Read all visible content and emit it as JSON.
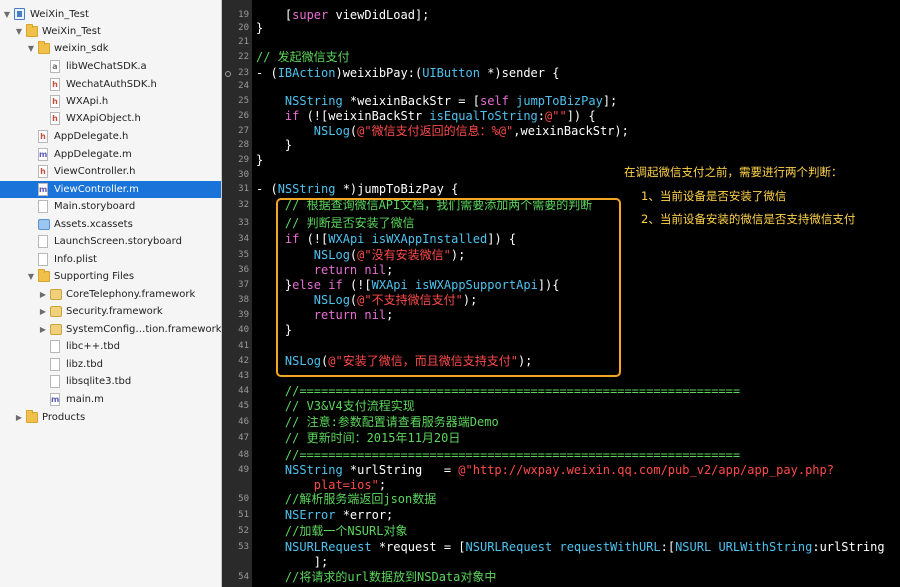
{
  "navigator": {
    "items": [
      {
        "label": "WeiXin_Test",
        "icon": "project-icon"
      },
      {
        "label": "WeiXin_Test",
        "icon": "group-folder-icon"
      },
      {
        "label": "weixin_sdk",
        "icon": "group-folder-icon"
      },
      {
        "label": "libWeChatSDK.a",
        "icon": "library-file-icon"
      },
      {
        "label": "WechatAuthSDK.h",
        "icon": "header-file-icon"
      },
      {
        "label": "WXApi.h",
        "icon": "header-file-icon"
      },
      {
        "label": "WXApiObject.h",
        "icon": "header-file-icon"
      },
      {
        "label": "AppDelegate.h",
        "icon": "header-file-icon"
      },
      {
        "label": "AppDelegate.m",
        "icon": "implementation-file-icon"
      },
      {
        "label": "ViewController.h",
        "icon": "header-file-icon"
      },
      {
        "label": "ViewController.m",
        "icon": "implementation-file-icon"
      },
      {
        "label": "Main.storyboard",
        "icon": "storyboard-file-icon"
      },
      {
        "label": "Assets.xcassets",
        "icon": "asset-catalog-icon"
      },
      {
        "label": "LaunchScreen.storyboard",
        "icon": "storyboard-file-icon"
      },
      {
        "label": "Info.plist",
        "icon": "plist-file-icon"
      },
      {
        "label": "Supporting Files",
        "icon": "group-folder-icon"
      },
      {
        "label": "CoreTelephony.framework",
        "icon": "framework-icon"
      },
      {
        "label": "Security.framework",
        "icon": "framework-icon"
      },
      {
        "label": "SystemConfig…tion.framework",
        "icon": "framework-icon"
      },
      {
        "label": "libc++.tbd",
        "icon": "library-file-icon"
      },
      {
        "label": "libz.tbd",
        "icon": "library-file-icon"
      },
      {
        "label": "libsqlite3.tbd",
        "icon": "library-file-icon"
      },
      {
        "label": "main.m",
        "icon": "implementation-file-icon"
      },
      {
        "label": "Products",
        "icon": "group-folder-icon"
      }
    ],
    "selected": "ViewController.m"
  },
  "editor": {
    "line_numbers": [
      "19",
      "20",
      "21",
      "22",
      "23",
      "24",
      "25",
      "26",
      "27",
      "28",
      "29",
      "30",
      "31",
      "32",
      "33",
      "34",
      "35",
      "36",
      "37",
      "38",
      "39",
      "40",
      "41",
      "42",
      "43",
      "44",
      "45",
      "46",
      "47",
      "48",
      "49",
      "",
      "50",
      "51",
      "52",
      "53",
      "",
      "54"
    ]
  },
  "code": {
    "l19a": "    [",
    "l19b": "super",
    "l19c": " viewDidLoad];",
    "l20": "}",
    "l22": "// 发起微信支付",
    "l23a": "- (",
    "l23b": "IBAction",
    "l23c": ")weixibPay:(",
    "l23d": "UIButton",
    "l23e": " *)sender {",
    "l25a": "    ",
    "l25b": "NSString",
    "l25c": " *weixinBackStr = [",
    "l25d": "self",
    "l25e": " ",
    "l25f": "jumpToBizPay",
    "l25g": "];",
    "l26a": "    ",
    "l26b": "if",
    "l26c": " (![weixinBackStr ",
    "l26d": "isEqualToString",
    "l26e": ":",
    "l26f": "@\"\"",
    "l26g": "]) {",
    "l27a": "        ",
    "l27b": "NSLog",
    "l27c": "(",
    "l27d": "@\"微信支付返回的信息：%@\"",
    "l27e": ",weixinBackStr);",
    "l28": "    }",
    "l29": "}",
    "l31a": "- (",
    "l31b": "NSString",
    "l31c": " *)jumpToBizPay {",
    "l32": "    // 根据查询微信API文档，我们需要添加两个需要的判断",
    "l33": "    // 判断是否安装了微信",
    "l34a": "    ",
    "l34b": "if",
    "l34c": " (![",
    "l34d": "WXApi",
    "l34e": " ",
    "l34f": "isWXAppInstalled",
    "l34g": "]) {",
    "l35a": "        ",
    "l35b": "NSLog",
    "l35c": "(",
    "l35d": "@\"没有安装微信\"",
    "l35e": ");",
    "l36a": "        ",
    "l36b": "return",
    "l36c": " ",
    "l36d": "nil",
    "l36e": ";",
    "l37a": "    }",
    "l37b": "else",
    "l37c": " ",
    "l37d": "if",
    "l37e": " (![",
    "l37f": "WXApi",
    "l37g": " ",
    "l37h": "isWXAppSupportApi",
    "l37i": "]){",
    "l38a": "        ",
    "l38b": "NSLog",
    "l38c": "(",
    "l38d": "@\"不支持微信支付\"",
    "l38e": ");",
    "l39a": "        ",
    "l39b": "return",
    "l39c": " ",
    "l39d": "nil",
    "l39e": ";",
    "l40": "    }",
    "l42a": "    ",
    "l42b": "NSLog",
    "l42c": "(",
    "l42d": "@\"安装了微信，而且微信支持支付\"",
    "l42e": ");",
    "l44": "    //=============================================================",
    "l45": "    // V3&V4支付流程实现",
    "l46": "    // 注意:参数配置请查看服务器端Demo",
    "l47": "    // 更新时间：2015年11月20日",
    "l48": "    //=============================================================",
    "l49a": "    ",
    "l49b": "NSString",
    "l49c": " *urlString   = ",
    "l49d": "@\"http://wxpay.weixin.qq.com/pub_v2/app/app_pay.php?",
    "l49w": "        plat=ios\"",
    "l49x": ";",
    "l50": "    //解析服务端返回json数据",
    "l51a": "    ",
    "l51b": "NSError",
    "l51c": " *error;",
    "l52": "    //加载一个NSURL对象",
    "l53a": "    ",
    "l53b": "NSURLRequest",
    "l53c": " *request = [",
    "l53d": "NSURLRequest",
    "l53e": " ",
    "l53f": "requestWithURL",
    "l53g": ":[",
    "l53h": "NSURL",
    "l53i": " ",
    "l53j": "URLWithString",
    "l53k": ":urlString",
    "l53w": "        ];",
    "l54": "    //将请求的url数据放到NSData对象中"
  },
  "annotations": {
    "heading": "在调起微信支付之前，需要进行两个判断：",
    "point1": "1、当前设备是否安装了微信",
    "point2": "2、当前设备安装的微信是否支持微信支付"
  }
}
